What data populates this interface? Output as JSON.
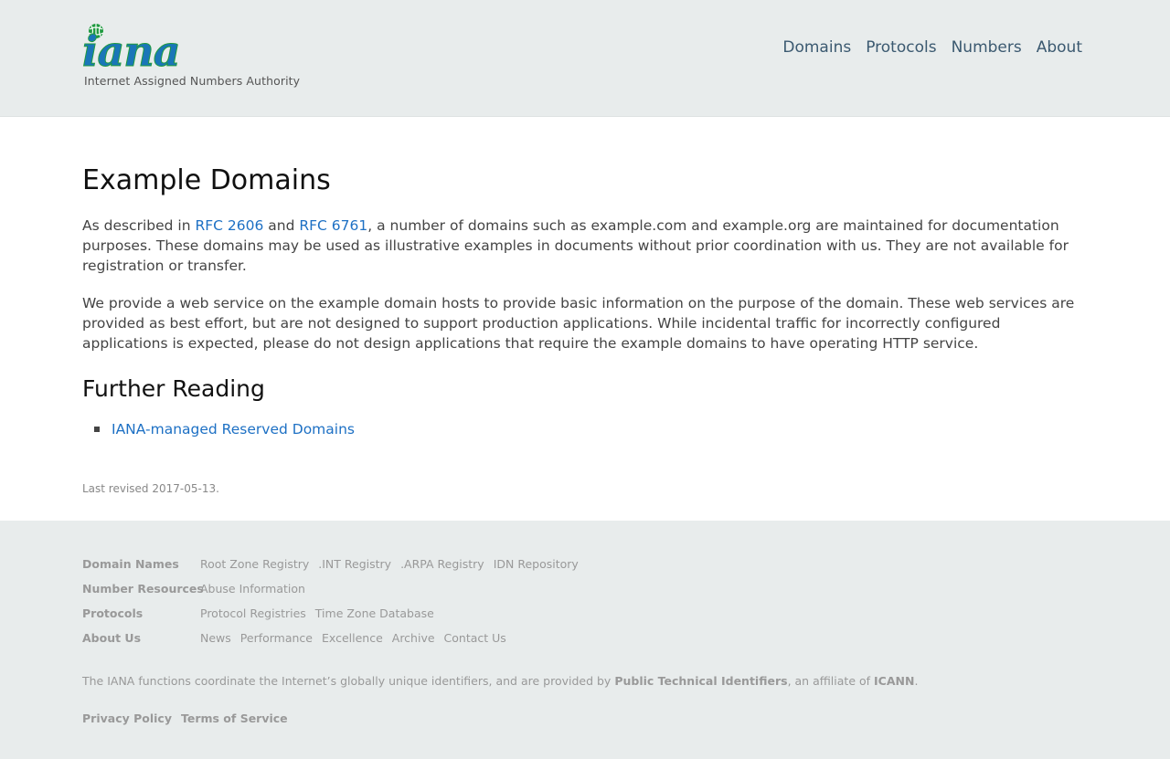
{
  "header": {
    "logo_text": "iana",
    "logo_tagline": "Internet Assigned Numbers Authority",
    "nav": [
      "Domains",
      "Protocols",
      "Numbers",
      "About"
    ]
  },
  "main": {
    "title": "Example Domains",
    "para1": {
      "before": "As described in ",
      "link1": "RFC 2606",
      "mid": " and ",
      "link2": "RFC 6761",
      "after": ", a number of domains such as example.com and example.org are maintained for documentation purposes. These domains may be used as illustrative examples in documents without prior coordination with us. They are not available for registration or transfer."
    },
    "para2": "We provide a web service on the example domain hosts to provide basic information on the purpose of the domain. These web services are provided as best effort, but are not designed to support production applications. While incidental traffic for incorrectly configured applications is expected, please do not design applications that require the example domains to have operating HTTP service.",
    "further_reading_title": "Further Reading",
    "further_reading": [
      "IANA-managed Reserved Domains"
    ],
    "last_revised": "Last revised 2017-05-13."
  },
  "footer": {
    "rows": [
      {
        "heading": "Domain Names",
        "links": [
          "Root Zone Registry",
          ".INT Registry",
          ".ARPA Registry",
          "IDN Repository"
        ]
      },
      {
        "heading": "Number Resources",
        "links": [
          "Abuse Information"
        ]
      },
      {
        "heading": "Protocols",
        "links": [
          "Protocol Registries",
          "Time Zone Database"
        ]
      },
      {
        "heading": "About Us",
        "links": [
          "News",
          "Performance",
          "Excellence",
          "Archive",
          "Contact Us"
        ]
      }
    ],
    "note": {
      "before": "The IANA functions coordinate the Internet’s globally unique identifiers, and are provided by ",
      "strong1": "Public Technical Identifiers",
      "mid": ", an affiliate of ",
      "strong2": "ICANN",
      "after": "."
    },
    "policy_links": [
      "Privacy Policy",
      "Terms of Service"
    ]
  },
  "colors": {
    "link": "#1d70c4",
    "header_bg": "#e8ecec",
    "nav": "#3b5970",
    "logo_blue": "#1a76b8",
    "logo_green": "#1f9a3f"
  }
}
